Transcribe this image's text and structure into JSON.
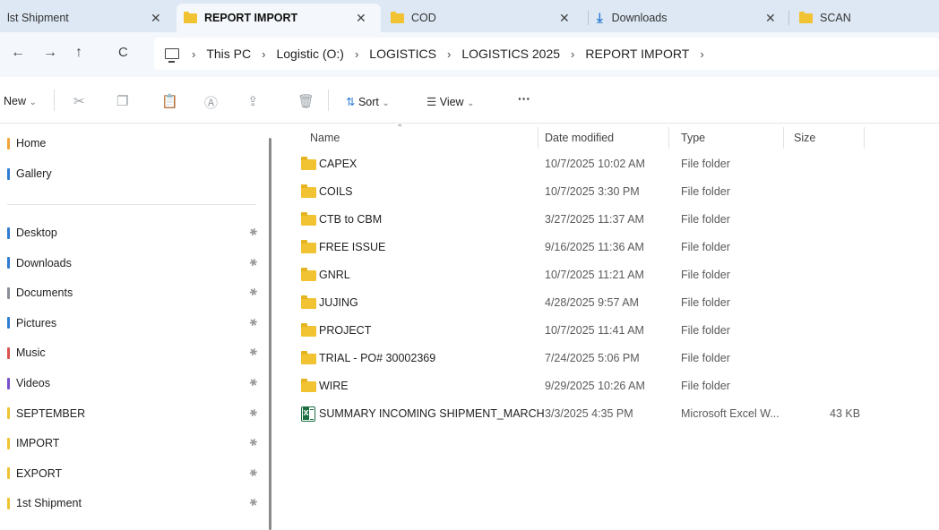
{
  "tabs": [
    {
      "label": "lst Shipment",
      "icon": "none",
      "active": false
    },
    {
      "label": "REPORT IMPORT",
      "icon": "folder-icon",
      "active": true
    },
    {
      "label": "COD",
      "icon": "folder-icon",
      "active": false
    },
    {
      "label": "Downloads",
      "icon": "download-icon",
      "active": false
    },
    {
      "label": "SCAN",
      "icon": "folder-icon",
      "active": false
    }
  ],
  "tab_close_glyph": "✕",
  "nav": {
    "back": "←",
    "forward": "→",
    "up": "↑",
    "refresh": "C"
  },
  "breadcrumb": [
    "This PC",
    "Logistic (O:)",
    "LOGISTICS",
    "LOGISTICS 2025",
    "REPORT IMPORT"
  ],
  "breadcrumb_sep": "›",
  "toolbar": {
    "new_label": "New",
    "sort_label": "Sort",
    "view_label": "View",
    "more_label": "···",
    "dropdown_glyph": "⌄"
  },
  "sidebar": {
    "top_items": [
      {
        "label": "Home",
        "color": "#f2a33a"
      },
      {
        "label": "Gallery",
        "color": "#2f7cd3"
      }
    ],
    "quick_access": [
      {
        "label": "Desktop",
        "color": "#2f7cd3"
      },
      {
        "label": "Downloads",
        "color": "#2f7cd3"
      },
      {
        "label": "Documents",
        "color": "#8a8f98"
      },
      {
        "label": "Pictures",
        "color": "#2f7cd3"
      },
      {
        "label": "Music",
        "color": "#d9534f"
      },
      {
        "label": "Videos",
        "color": "#7a4fc9"
      },
      {
        "label": "SEPTEMBER",
        "color": "#f1c232"
      },
      {
        "label": "IMPORT",
        "color": "#f1c232"
      },
      {
        "label": "EXPORT",
        "color": "#f1c232"
      },
      {
        "label": "1st Shipment",
        "color": "#f1c232"
      }
    ],
    "pin_glyph": "📌"
  },
  "columns": {
    "name": "Name",
    "date": "Date modified",
    "type": "Type",
    "size": "Size"
  },
  "files": [
    {
      "name": "CAPEX",
      "date": "10/7/2025 10:02 AM",
      "type": "File folder",
      "size": "",
      "kind": "folder"
    },
    {
      "name": "COILS",
      "date": "10/7/2025 3:30 PM",
      "type": "File folder",
      "size": "",
      "kind": "folder"
    },
    {
      "name": "CTB to CBM",
      "date": "3/27/2025 11:37 AM",
      "type": "File folder",
      "size": "",
      "kind": "folder"
    },
    {
      "name": "FREE ISSUE",
      "date": "9/16/2025 11:36 AM",
      "type": "File folder",
      "size": "",
      "kind": "folder"
    },
    {
      "name": "GNRL",
      "date": "10/7/2025 11:21 AM",
      "type": "File folder",
      "size": "",
      "kind": "folder"
    },
    {
      "name": "JUJING",
      "date": "4/28/2025 9:57 AM",
      "type": "File folder",
      "size": "",
      "kind": "folder"
    },
    {
      "name": "PROJECT",
      "date": "10/7/2025 11:41 AM",
      "type": "File folder",
      "size": "",
      "kind": "folder"
    },
    {
      "name": "TRIAL - PO# 30002369",
      "date": "7/24/2025 5:06 PM",
      "type": "File folder",
      "size": "",
      "kind": "folder"
    },
    {
      "name": "WIRE",
      "date": "9/29/2025 10:26 AM",
      "type": "File folder",
      "size": "",
      "kind": "folder"
    },
    {
      "name": "SUMMARY INCOMING SHIPMENT_MARCH",
      "date": "3/3/2025 4:35 PM",
      "type": "Microsoft Excel W...",
      "size": "43 KB",
      "kind": "excel"
    }
  ]
}
